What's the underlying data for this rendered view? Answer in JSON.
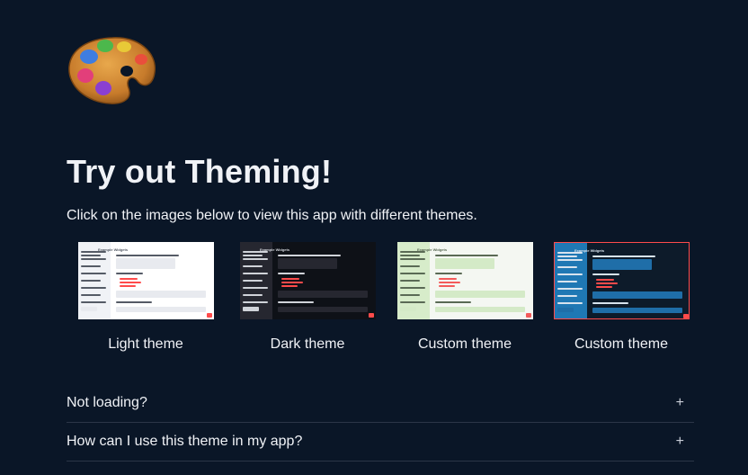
{
  "header": {
    "emoji_icon": "artist-palette-icon",
    "title": "Try out Theming!",
    "subtitle": "Click on the images below to view this app with different themes."
  },
  "themes": [
    {
      "label": "Light theme",
      "preview": {
        "sidebar": "#f0f2f6",
        "main": "#ffffff",
        "text": "#555b66",
        "accent": "#ff4b4b",
        "panel": "#e8eaef"
      }
    },
    {
      "label": "Dark theme",
      "preview": {
        "sidebar": "#262730",
        "main": "#0e1117",
        "text": "#d0d3d9",
        "accent": "#ff4b4b",
        "panel": "#262730"
      }
    },
    {
      "label": "Custom theme",
      "preview": {
        "sidebar": "#d7ecca",
        "main": "#f4f7f2",
        "text": "#5a6a55",
        "accent": "#f35a5a",
        "panel": "#d4eac7"
      }
    },
    {
      "label": "Custom theme",
      "preview": {
        "sidebar": "#1f78b4",
        "main": "#0d1b2a",
        "text": "#d7e3ee",
        "accent": "#ff4b4b",
        "panel": "#1f6ea8"
      }
    }
  ],
  "preview_heading": "Example Widgets",
  "expanders": [
    {
      "label": "Not loading?",
      "icon": "plus-icon"
    },
    {
      "label": "How can I use this theme in my app?",
      "icon": "plus-icon"
    }
  ],
  "colors": {
    "background": "#0a1627",
    "text": "#f0f2f6",
    "divider": "#2b3547",
    "selected_border": "#ff4b4b"
  }
}
